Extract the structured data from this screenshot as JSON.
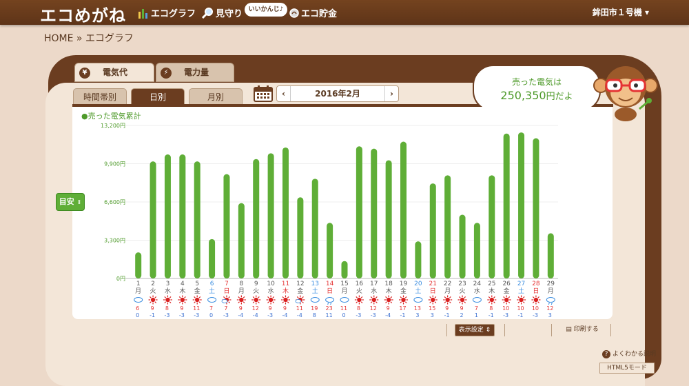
{
  "nav": {
    "logo": "エコめがね",
    "items": [
      {
        "label": "エコグラフ",
        "icon": "bar-graph-icon"
      },
      {
        "label": "見守り",
        "icon": "magnifier-icon"
      },
      {
        "label": "エコ貯金",
        "icon": "coin-icon"
      }
    ],
    "bubble": "いいかんじ♪",
    "user": "鉾田市１号機"
  },
  "breadcrumb": "HOME » エコグラフ",
  "tabs_top": [
    {
      "label": "電気代",
      "icon": "yen-icon",
      "active": true
    },
    {
      "label": "電力量",
      "icon": "lightning-icon",
      "active": false
    }
  ],
  "tabs_sub": [
    {
      "label": "時間帯別",
      "active": false
    },
    {
      "label": "日別",
      "active": true
    },
    {
      "label": "月別",
      "active": false
    }
  ],
  "month": {
    "prev": "‹",
    "label": "2016年2月",
    "next": "›"
  },
  "speech": {
    "line1": "売った電気は",
    "amount": "250,350",
    "suffix": "円だよ"
  },
  "legend": "●売った電気累計",
  "meyasu": "目安",
  "buttons": {
    "display": "表示設定",
    "print": "印刷する"
  },
  "help": "よくわかる説明",
  "html5": "HTML5モード",
  "colors": {
    "bar": "#5fae37",
    "brown": "#6b3d20",
    "weekend_red": "#e53333",
    "weekend_blue": "#3a8de0"
  },
  "chart_data": {
    "type": "bar",
    "title": "",
    "ylabel": "",
    "ylim": [
      0,
      13200
    ],
    "yticks": [
      "0円",
      "3,300円",
      "6,600円",
      "9,900円",
      "13,200円"
    ],
    "ytick_values": [
      0,
      3300,
      6600,
      9900,
      13200
    ],
    "days": [
      {
        "d": "1",
        "w": "月",
        "wx": "cloud",
        "hi": "6",
        "lo": "0",
        "v": 2250
      },
      {
        "d": "2",
        "w": "火",
        "wx": "sun",
        "hi": "9",
        "lo": "-1",
        "v": 10100
      },
      {
        "d": "3",
        "w": "水",
        "wx": "sun",
        "hi": "8",
        "lo": "-3",
        "v": 10700
      },
      {
        "d": "4",
        "w": "木",
        "wx": "sun",
        "hi": "9",
        "lo": "-3",
        "v": 10700
      },
      {
        "d": "5",
        "w": "金",
        "wx": "sun",
        "hi": "11",
        "lo": "-3",
        "v": 10100
      },
      {
        "d": "6",
        "w": "土",
        "wx": "cloud",
        "hi": "7",
        "lo": "0",
        "v": 3400
      },
      {
        "d": "7",
        "w": "日",
        "wx": "cloud-sun",
        "hi": "7",
        "lo": "-3",
        "v": 9000
      },
      {
        "d": "8",
        "w": "月",
        "wx": "sun",
        "hi": "9",
        "lo": "-4",
        "v": 6500
      },
      {
        "d": "9",
        "w": "火",
        "wx": "sun",
        "hi": "12",
        "lo": "-4",
        "v": 10300
      },
      {
        "d": "10",
        "w": "水",
        "wx": "sun",
        "hi": "9",
        "lo": "-3",
        "v": 10800
      },
      {
        "d": "11",
        "w": "木",
        "wx": "sun",
        "hi": "9",
        "lo": "-4",
        "v": 11300
      },
      {
        "d": "12",
        "w": "金",
        "wx": "cloud-sun",
        "hi": "11",
        "lo": "-4",
        "v": 7000
      },
      {
        "d": "13",
        "w": "土",
        "wx": "cloud",
        "hi": "19",
        "lo": "8",
        "v": 8600
      },
      {
        "d": "14",
        "w": "日",
        "wx": "rain",
        "hi": "23",
        "lo": "11",
        "v": 4800
      },
      {
        "d": "15",
        "w": "月",
        "wx": "cloud",
        "hi": "11",
        "lo": "0",
        "v": 1500
      },
      {
        "d": "16",
        "w": "火",
        "wx": "sun",
        "hi": "8",
        "lo": "-3",
        "v": 11400
      },
      {
        "d": "17",
        "w": "水",
        "wx": "sun",
        "hi": "12",
        "lo": "-3",
        "v": 11200
      },
      {
        "d": "18",
        "w": "木",
        "wx": "sun",
        "hi": "9",
        "lo": "-4",
        "v": 10200
      },
      {
        "d": "19",
        "w": "金",
        "wx": "sun",
        "hi": "17",
        "lo": "-1",
        "v": 11800
      },
      {
        "d": "20",
        "w": "土",
        "wx": "cloud",
        "hi": "13",
        "lo": "3",
        "v": 3200
      },
      {
        "d": "21",
        "w": "日",
        "wx": "sun",
        "hi": "15",
        "lo": "3",
        "v": 8200
      },
      {
        "d": "22",
        "w": "月",
        "wx": "sun",
        "hi": "9",
        "lo": "-1",
        "v": 8900
      },
      {
        "d": "23",
        "w": "火",
        "wx": "sun",
        "hi": "9",
        "lo": "2",
        "v": 5500
      },
      {
        "d": "24",
        "w": "水",
        "wx": "cloud",
        "hi": "7",
        "lo": "1",
        "v": 4800
      },
      {
        "d": "25",
        "w": "木",
        "wx": "sun",
        "hi": "8",
        "lo": "-1",
        "v": 8900
      },
      {
        "d": "26",
        "w": "金",
        "wx": "sun",
        "hi": "10",
        "lo": "-3",
        "v": 12500
      },
      {
        "d": "27",
        "w": "土",
        "wx": "sun",
        "hi": "10",
        "lo": "-1",
        "v": 12600
      },
      {
        "d": "28",
        "w": "日",
        "wx": "sun",
        "hi": "10",
        "lo": "-3",
        "v": 12100
      },
      {
        "d": "29",
        "w": "月",
        "wx": "rain",
        "hi": "12",
        "lo": "3",
        "v": 3900
      }
    ]
  }
}
